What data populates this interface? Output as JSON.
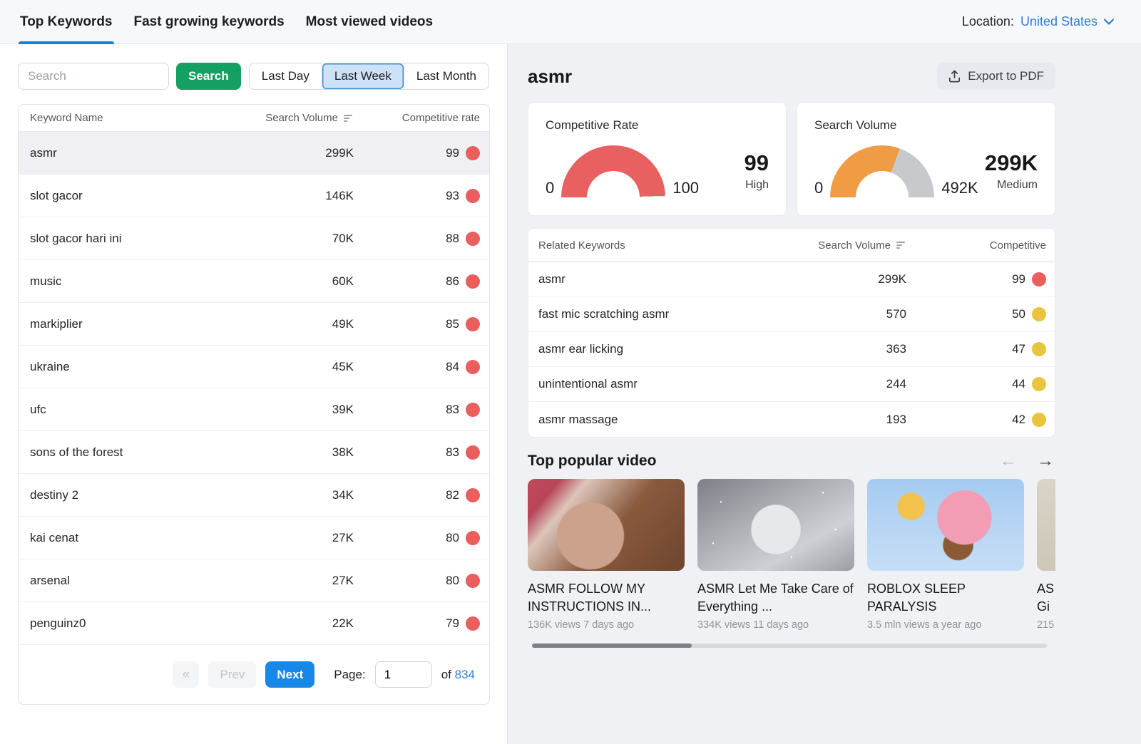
{
  "tabs": [
    {
      "label": "Top Keywords"
    },
    {
      "label": "Fast growing keywords"
    },
    {
      "label": "Most viewed videos"
    }
  ],
  "location": {
    "label": "Location:",
    "value": "United States"
  },
  "left_panel": {
    "search": {
      "placeholder": "Search",
      "button_label": "Search"
    },
    "time_filters": [
      {
        "label": "Last Day"
      },
      {
        "label": "Last Week"
      },
      {
        "label": "Last Month"
      }
    ],
    "table": {
      "columns": [
        "Keyword Name",
        "Search Volume",
        "Competitive rate"
      ],
      "rows": [
        {
          "keyword": "asmr",
          "volume": "299K",
          "rate": "99",
          "dot": "red"
        },
        {
          "keyword": "slot gacor",
          "volume": "146K",
          "rate": "93",
          "dot": "red"
        },
        {
          "keyword": "slot gacor hari ini",
          "volume": "70K",
          "rate": "88",
          "dot": "red"
        },
        {
          "keyword": "music",
          "volume": "60K",
          "rate": "86",
          "dot": "red"
        },
        {
          "keyword": "markiplier",
          "volume": "49K",
          "rate": "85",
          "dot": "red"
        },
        {
          "keyword": "ukraine",
          "volume": "45K",
          "rate": "84",
          "dot": "red"
        },
        {
          "keyword": "ufc",
          "volume": "39K",
          "rate": "83",
          "dot": "red"
        },
        {
          "keyword": "sons of the forest",
          "volume": "38K",
          "rate": "83",
          "dot": "red"
        },
        {
          "keyword": "destiny 2",
          "volume": "34K",
          "rate": "82",
          "dot": "red"
        },
        {
          "keyword": "kai cenat",
          "volume": "27K",
          "rate": "80",
          "dot": "red"
        },
        {
          "keyword": "arsenal",
          "volume": "27K",
          "rate": "80",
          "dot": "red"
        },
        {
          "keyword": "penguinz0",
          "volume": "22K",
          "rate": "79",
          "dot": "red"
        }
      ]
    },
    "pagination": {
      "first_label": "«",
      "prev_label": "Prev",
      "next_label": "Next",
      "page_label": "Page:",
      "page_value": "1",
      "of_label": "of",
      "total_pages": "834"
    }
  },
  "right_panel": {
    "title": "asmr",
    "export_label": "Export to PDF",
    "gauges": [
      {
        "title": "Competitive Rate",
        "min": "0",
        "max": "100",
        "value": "99",
        "level": "High",
        "fill_pct": 99,
        "fill_color": "#e8605f",
        "track_color": "#e9e9ea"
      },
      {
        "title": "Search Volume",
        "min": "0",
        "max": "492K",
        "value": "299K",
        "level": "Medium",
        "fill_pct": 61,
        "fill_color": "#f09c44",
        "track_color": "#c7c9cd"
      }
    ],
    "related": {
      "columns": [
        "Related Keywords",
        "Search Volume",
        "Competitive"
      ],
      "rows": [
        {
          "keyword": "asmr",
          "volume": "299K",
          "rate": "99",
          "dot": "red"
        },
        {
          "keyword": "fast mic scratching asmr",
          "volume": "570",
          "rate": "50",
          "dot": "yellow"
        },
        {
          "keyword": "asmr ear licking",
          "volume": "363",
          "rate": "47",
          "dot": "yellow"
        },
        {
          "keyword": "unintentional asmr",
          "volume": "244",
          "rate": "44",
          "dot": "yellow"
        },
        {
          "keyword": "asmr massage",
          "volume": "193",
          "rate": "42",
          "dot": "yellow"
        }
      ]
    },
    "videos": {
      "heading": "Top popular video",
      "arrow_left": "←",
      "arrow_right": "→",
      "items": [
        {
          "title": "ASMR FOLLOW MY INSTRUCTIONS IN...",
          "meta": "136K views 7 days ago"
        },
        {
          "title": "ASMR Let Me Take Care of Everything ...",
          "meta": "334K views 11 days ago"
        },
        {
          "title": "ROBLOX SLEEP PARALYSIS",
          "meta": "3.5 mln views a year ago"
        },
        {
          "title": "AS\nGi",
          "meta": "215"
        }
      ]
    }
  },
  "colors": {
    "accent_blue": "#1788e8",
    "tab_underline": "#1082e0",
    "link_blue": "#2f7ed8",
    "search_green": "#15a063",
    "red_dot": "#ea5e5e",
    "yellow_dot": "#e9c53f",
    "gauge_red": "#e8605f",
    "gauge_orange": "#f09c44",
    "panel_gray": "#f0f1f4"
  }
}
